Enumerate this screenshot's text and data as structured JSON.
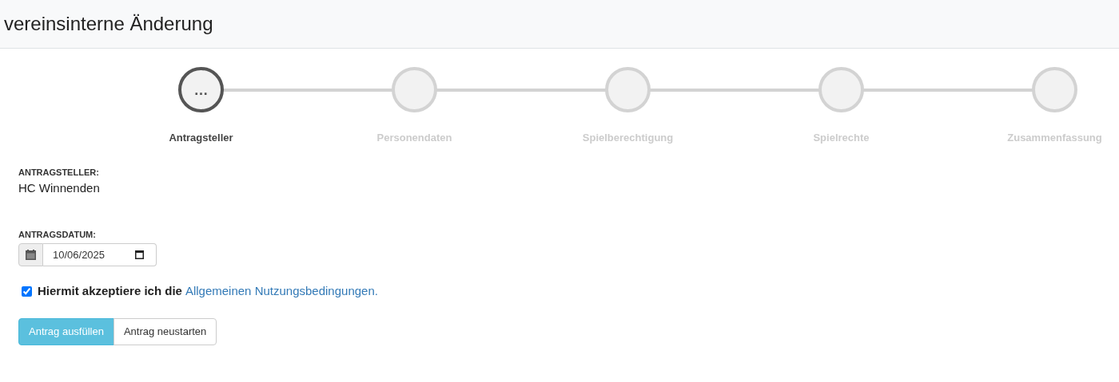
{
  "header": {
    "title": "vereinsinterne Änderung"
  },
  "steps": [
    {
      "label": "Antragsteller",
      "active": true,
      "icon": "…"
    },
    {
      "label": "Personendaten",
      "active": false
    },
    {
      "label": "Spielberechtigung",
      "active": false
    },
    {
      "label": "Spielrechte",
      "active": false
    },
    {
      "label": "Zusammenfassung",
      "active": false
    }
  ],
  "applicant": {
    "label": "ANTRAGSTELLER:",
    "value": "HC Winnenden"
  },
  "date": {
    "label": "ANTRAGSDATUM:",
    "value": "10/06/2025"
  },
  "terms": {
    "checked": true,
    "text": "Hiermit akzeptiere ich die",
    "link": "Allgemeinen Nutzungsbedingungen."
  },
  "buttons": [
    {
      "label": "Antrag ausfüllen",
      "kind": "primary"
    },
    {
      "label": "Antrag neustarten",
      "kind": "default"
    }
  ]
}
